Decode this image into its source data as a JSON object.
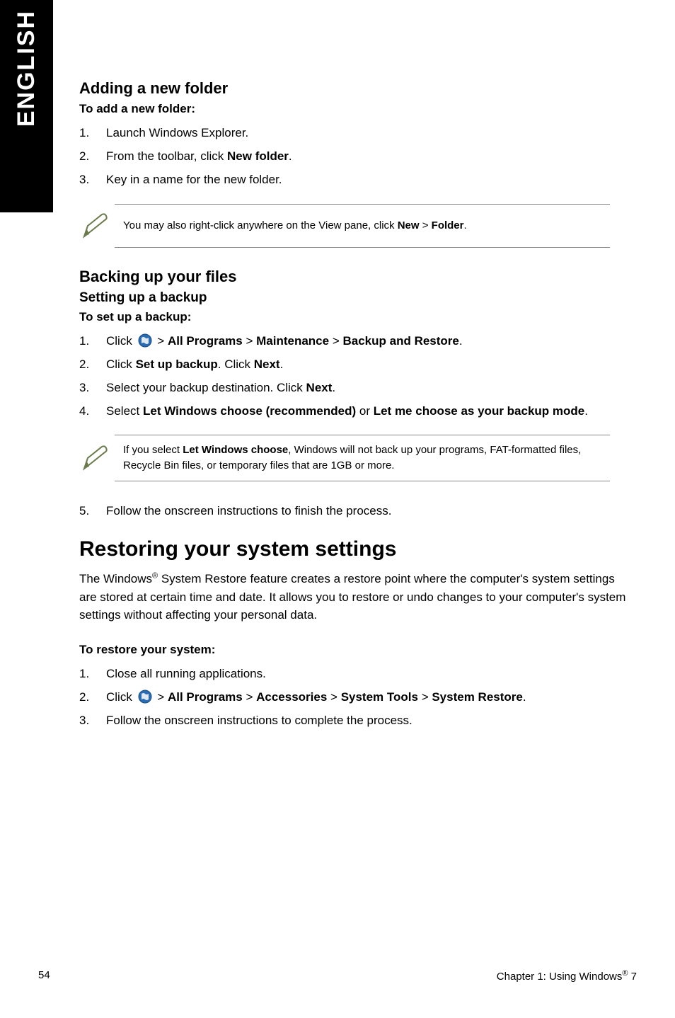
{
  "side_tab": {
    "label": "ENGLISH"
  },
  "section1": {
    "title": "Adding a new folder",
    "lead": "To add a new folder:",
    "steps": [
      {
        "num": "1.",
        "text_plain": "Launch Windows Explorer."
      },
      {
        "num": "2.",
        "prefix": "From the toolbar, click ",
        "bold1": "New folder",
        "suffix": "."
      },
      {
        "num": "3.",
        "text_plain": "Key in a name for the new folder."
      }
    ],
    "note": {
      "prefix": "You may also right-click anywhere on the View pane, click ",
      "bold1": "New",
      "mid": " > ",
      "bold2": "Folder",
      "suffix": "."
    }
  },
  "section2": {
    "title": "Backing up your files",
    "subtitle": "Setting up a backup",
    "lead": "To set up a backup:",
    "steps": [
      {
        "num": "1.",
        "prefix": "Click ",
        "icon": true,
        "mid": " > ",
        "bold1": "All Programs",
        "mid2": " > ",
        "bold2": "Maintenance",
        "mid3": " > ",
        "bold3": "Backup and Restore",
        "suffix": "."
      },
      {
        "num": "2.",
        "prefix": "Click ",
        "bold1": "Set up backup",
        "mid": ". Click ",
        "bold2": "Next",
        "suffix": "."
      },
      {
        "num": "3.",
        "prefix": "Select your backup destination. Click ",
        "bold1": "Next",
        "suffix": "."
      },
      {
        "num": "4.",
        "prefix": "Select ",
        "bold1": "Let Windows choose (recommended)",
        "mid": " or ",
        "bold2": "Let me choose as your backup mode",
        "suffix": "."
      }
    ],
    "note": {
      "prefix": "If you select ",
      "bold1": "Let Windows choose",
      "suffix": ", Windows will not back up your programs, FAT-formatted files, Recycle Bin files, or temporary files that are 1GB or more."
    },
    "step5": {
      "num": "5.",
      "text_plain": "Follow the onscreen instructions to finish the process."
    }
  },
  "section3": {
    "title": "Restoring your system settings",
    "para_prefix": "The Windows",
    "para_sup": "®",
    "para_rest": " System Restore feature creates a restore point where the computer's system settings are stored at certain time and date. It allows you to restore or undo changes to your computer's system settings without affecting your personal data.",
    "lead": "To restore your system:",
    "steps": [
      {
        "num": "1.",
        "text_plain": "Close all running applications."
      },
      {
        "num": "2.",
        "prefix": "Click ",
        "icon": true,
        "mid": " > ",
        "bold1": "All Programs",
        "mid2": " > ",
        "bold2": "Accessories",
        "mid3": " > ",
        "bold3": "System Tools",
        "mid4": " > ",
        "bold4": "System Restore",
        "suffix": "."
      },
      {
        "num": "3.",
        "text_plain": "Follow the onscreen instructions to complete the process."
      }
    ]
  },
  "footer": {
    "page_num": "54",
    "chapter_prefix": "Chapter 1: Using Windows",
    "chapter_sup": "®",
    "chapter_suffix": " 7"
  },
  "icons": {
    "start_button": "windows-start-icon",
    "pen_note": "pen-note-icon"
  }
}
